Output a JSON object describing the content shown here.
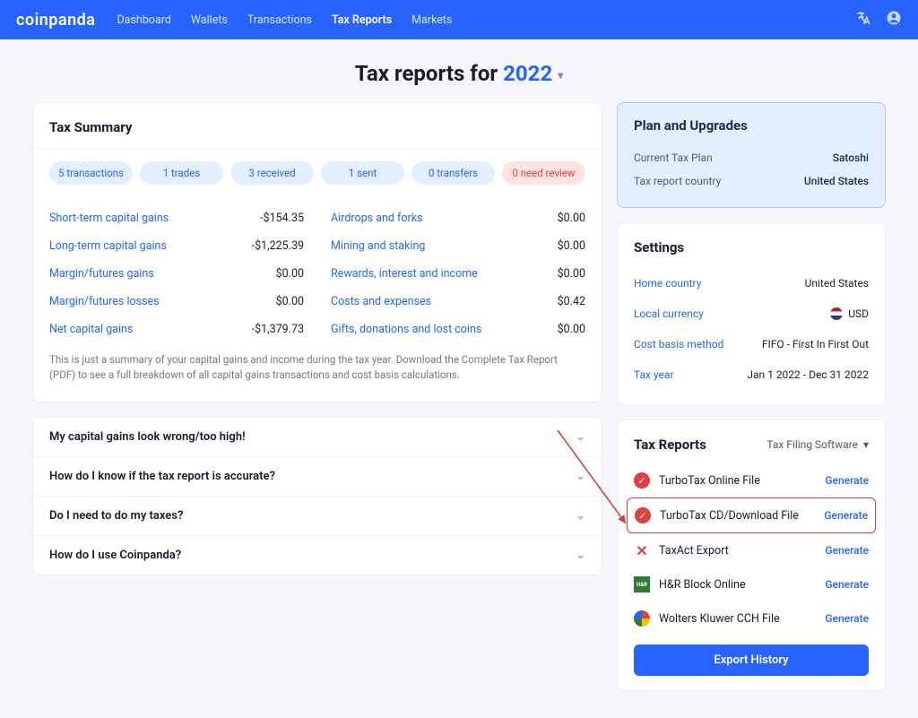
{
  "brand": "coinpanda",
  "nav": [
    {
      "label": "Dashboard",
      "active": false
    },
    {
      "label": "Wallets",
      "active": false
    },
    {
      "label": "Transactions",
      "active": false
    },
    {
      "label": "Tax Reports",
      "active": true
    },
    {
      "label": "Markets",
      "active": false
    }
  ],
  "title_prefix": "Tax reports for ",
  "title_year": "2022",
  "tax_summary": {
    "heading": "Tax Summary",
    "pills": [
      {
        "text": "5 transactions"
      },
      {
        "text": "1 trades"
      },
      {
        "text": "3 received"
      },
      {
        "text": "1 sent"
      },
      {
        "text": "0 transfers"
      },
      {
        "text": "0 need review",
        "variant": "red"
      }
    ],
    "left_rows": [
      {
        "label": "Short-term capital gains",
        "value": "-$154.35"
      },
      {
        "label": "Long-term capital gains",
        "value": "-$1,225.39"
      },
      {
        "label": "Margin/futures gains",
        "value": "$0.00"
      },
      {
        "label": "Margin/futures losses",
        "value": "$0.00"
      },
      {
        "label": "Net capital gains",
        "value": "-$1,379.73"
      }
    ],
    "right_rows": [
      {
        "label": "Airdrops and forks",
        "value": "$0.00"
      },
      {
        "label": "Mining and staking",
        "value": "$0.00"
      },
      {
        "label": "Rewards, interest and income",
        "value": "$0.00"
      },
      {
        "label": "Costs and expenses",
        "value": "$0.42"
      },
      {
        "label": "Gifts, donations and lost coins",
        "value": "$0.00"
      }
    ],
    "note": "This is just a summary of your capital gains and income during the tax year. Download the Complete Tax Report (PDF) to see a full breakdown of all capital gains transactions and cost basis calculations."
  },
  "faq": [
    "My capital gains look wrong/too high!",
    "How do I know if the tax report is accurate?",
    "Do I need to do my taxes?",
    "How do I use Coinpanda?"
  ],
  "plan": {
    "heading": "Plan and Upgrades",
    "rows": [
      {
        "k": "Current Tax Plan",
        "v": "Satoshi"
      },
      {
        "k": "Tax report country",
        "v": "United States"
      }
    ]
  },
  "settings": {
    "heading": "Settings",
    "rows": [
      {
        "k": "Home country",
        "v": "United States"
      },
      {
        "k": "Local currency",
        "v": "USD",
        "flag": true
      },
      {
        "k": "Cost basis method",
        "v": "FIFO - First In First Out"
      },
      {
        "k": "Tax year",
        "v": "Jan 1 2022 - Dec 31 2022"
      }
    ]
  },
  "reports": {
    "heading": "Tax Reports",
    "filter_label": "Tax Filing Software",
    "items": [
      {
        "name": "TurboTax Online File",
        "icon": "check",
        "action": "Generate"
      },
      {
        "name": "TurboTax CD/Download File",
        "icon": "check",
        "action": "Generate",
        "highlight": true
      },
      {
        "name": "TaxAct Export",
        "icon": "x",
        "action": "Generate"
      },
      {
        "name": "H&R Block Online",
        "icon": "hrb",
        "action": "Generate"
      },
      {
        "name": "Wolters Kluwer CCH File",
        "icon": "wk",
        "action": "Generate"
      }
    ],
    "export_btn": "Export History"
  }
}
